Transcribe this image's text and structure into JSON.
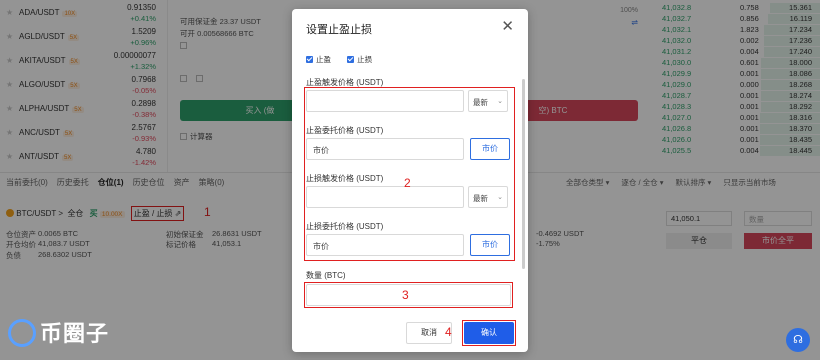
{
  "markets": [
    {
      "pair": "ADA/USDT",
      "lev": "10X",
      "price": "0.91350",
      "change": "+0.41%",
      "dir": "up"
    },
    {
      "pair": "AGLD/USDT",
      "lev": "5X",
      "price": "1.5209",
      "change": "+0.96%",
      "dir": "up"
    },
    {
      "pair": "AKITA/USDT",
      "lev": "5X",
      "price": "0.00000077",
      "change": "+1.32%",
      "dir": "up"
    },
    {
      "pair": "ALGO/USDT",
      "lev": "5X",
      "price": "0.7968",
      "change": "-0.05%",
      "dir": "down"
    },
    {
      "pair": "ALPHA/USDT",
      "lev": "5X",
      "price": "0.2898",
      "change": "-0.38%",
      "dir": "down"
    },
    {
      "pair": "ANC/USDT",
      "lev": "5X",
      "price": "2.5767",
      "change": "-0.93%",
      "dir": "down"
    },
    {
      "pair": "ANT/USDT",
      "lev": "5X",
      "price": "4.780",
      "change": "-1.42%",
      "dir": "down"
    }
  ],
  "form": {
    "available_margin": "可用保证金 23.37 USDT",
    "max_open": "可开 0.00568666 BTC",
    "pct_label": "100%",
    "calc_label": "计算器",
    "buy_label": "买入 (做",
    "sell_label": "空) BTC"
  },
  "order_book": [
    {
      "price": "41,032.8",
      "qty": "0.758",
      "total": "15.361"
    },
    {
      "price": "41,032.7",
      "qty": "0.856",
      "total": "16.119"
    },
    {
      "price": "41,032.1",
      "qty": "1.823",
      "total": "17.234"
    },
    {
      "price": "41,032.0",
      "qty": "0.002",
      "total": "17.236"
    },
    {
      "price": "41,031.2",
      "qty": "0.004",
      "total": "17.240"
    },
    {
      "price": "41,030.0",
      "qty": "0.601",
      "total": "18.000"
    },
    {
      "price": "41,029.9",
      "qty": "0.001",
      "total": "18.086"
    },
    {
      "price": "41,029.0",
      "qty": "0.000",
      "total": "18.268"
    },
    {
      "price": "41,028.7",
      "qty": "0.001",
      "total": "18.274"
    },
    {
      "price": "41,028.3",
      "qty": "0.001",
      "total": "18.292"
    },
    {
      "price": "41,027.0",
      "qty": "0.001",
      "total": "18.316"
    },
    {
      "price": "41,026.8",
      "qty": "0.001",
      "total": "18.370"
    },
    {
      "price": "41,026.0",
      "qty": "0.001",
      "total": "18.435"
    },
    {
      "price": "41,025.5",
      "qty": "0.004",
      "total": "18.445"
    }
  ],
  "bottom": {
    "tabs": [
      "当前委托(0)",
      "历史委托",
      "仓位(1)",
      "历史仓位",
      "资产",
      "策略(0)"
    ],
    "filters": [
      "全部仓类型 ▾",
      "逐仓 / 全仓 ▾",
      "默认排序 ▾",
      "只显示当前市场"
    ],
    "pair": "BTC/USDT >",
    "mode": "全仓",
    "side": "买",
    "lev": "10.00X",
    "tpsl_link": "止盈 / 止损",
    "pos_size_label": "仓位资产",
    "pos_size": "0.0065 BTC",
    "avg_price_label": "开仓均价",
    "avg_price": "41,083.7 USDT",
    "liab_label": "负债",
    "liab": "268.6302 USDT",
    "init_margin_label": "初始保证金",
    "init_margin": "26.8631 USDT",
    "mark_price_label": "标记价格",
    "mark_price": "41,053.1",
    "pnl": "-0.4692 USDT",
    "pnl_pct": "-1.75%",
    "close_price": "41,050.1",
    "qty_placeholder": "数量",
    "close_btn": "平仓",
    "market_close_btn": "市价全平"
  },
  "annotations": {
    "a1": "1",
    "a2": "2",
    "a3": "3",
    "a4": "4"
  },
  "modal": {
    "title": "设置止盈止损",
    "tp_check": "止盈",
    "sl_check": "止损",
    "tp_trigger_label": "止盈触发价格 (USDT)",
    "tp_trigger_type": "最新",
    "tp_order_label": "止盈委托价格 (USDT)",
    "tp_order_value": "市价",
    "tp_market_btn": "市价",
    "sl_trigger_label": "止损触发价格 (USDT)",
    "sl_trigger_type": "最新",
    "sl_order_label": "止损委托价格 (USDT)",
    "sl_order_value": "市价",
    "sl_market_btn": "市价",
    "qty_label": "数量 (BTC)",
    "cancel": "取消",
    "confirm": "确认"
  },
  "watermark": "币圈子"
}
